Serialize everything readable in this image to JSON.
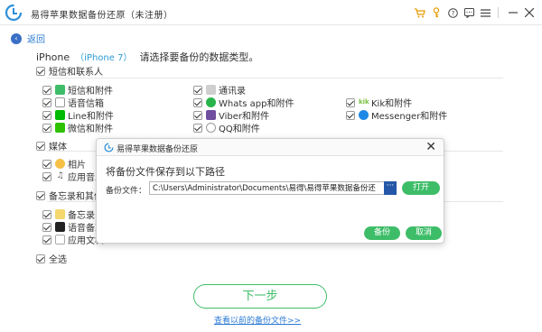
{
  "app": {
    "title": "易得苹果数据备份还原（未注册）"
  },
  "nav": {
    "back_label": "返回"
  },
  "header": {
    "device": "iPhone",
    "model": "（iPhone 7）",
    "message": "请选择要备份的数据类型。"
  },
  "sections": {
    "messages": {
      "label": "短信和联系人",
      "items": [
        "短信和附件",
        "通讯录",
        "语音信箱",
        "Whats app和附件",
        "Kik和附件",
        "Line和附件",
        "Viber和附件",
        "Messenger和附件",
        "微信和附件",
        "QQ和附件"
      ]
    },
    "media": {
      "label": "媒体",
      "items": [
        "相片",
        "应用音乐"
      ]
    },
    "memo": {
      "label": "备忘录和其他",
      "items": [
        "备忘录",
        "语音备忘",
        "应用文档"
      ]
    },
    "select_all": {
      "label": "全选"
    }
  },
  "dialog": {
    "title": "易得苹果数据备份还原",
    "heading": "将备份文件保存到以下路径",
    "path_label": "备份文件：",
    "path_value": "C:\\Users\\Administrator\\Documents\\易得\\易得苹果数据备份还",
    "browse_label": "···",
    "open_label": "打开",
    "backup_label": "备份",
    "cancel_label": "取消"
  },
  "footer": {
    "next_label": "下一步",
    "prev_link": "查看以前的备份文件>>"
  },
  "colors": {
    "accent_green": "#3ebd68",
    "link_blue": "#2d7bd5",
    "brand_blue": "#2457a8"
  }
}
